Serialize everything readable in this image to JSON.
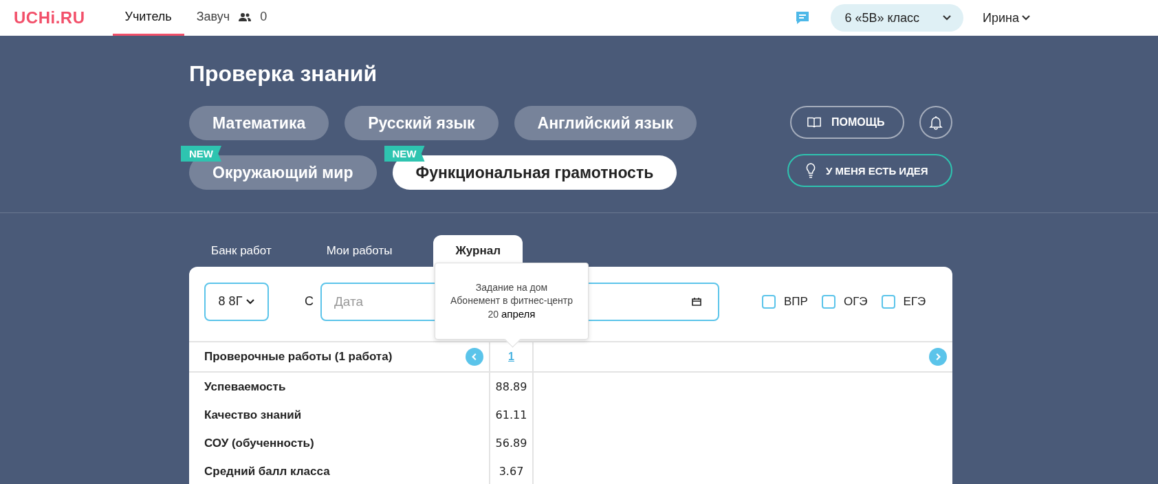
{
  "header": {
    "logo": "UCHi.RU",
    "nav": [
      {
        "label": "Учитель",
        "selected": true
      },
      {
        "label": "Завуч",
        "selected": false,
        "count": "0"
      }
    ],
    "class_selector": "6 «5В» класс",
    "user": "Ирина"
  },
  "title": "Проверка знаний",
  "subject_rows": [
    [
      {
        "label": "Математика",
        "selected": false
      },
      {
        "label": "Русский язык",
        "selected": false
      },
      {
        "label": "Английский язык",
        "selected": false
      }
    ],
    [
      {
        "label": "Окружающий мир",
        "selected": false,
        "badge": "NEW"
      },
      {
        "label": "Функциональная грамотность",
        "selected": true,
        "badge": "NEW"
      }
    ]
  ],
  "help_button": "ПОМОЩЬ",
  "idea_button": "У МЕНЯ ЕСТЬ ИДЕЯ",
  "tabs": [
    {
      "label": "Банк работ",
      "selected": false
    },
    {
      "label": "Мои работы",
      "selected": false
    },
    {
      "label": "Журнал",
      "selected": true
    }
  ],
  "filters": {
    "class": "8 8Г",
    "from_label": "С",
    "date_placeholder": "Дата",
    "exams": [
      {
        "label": "ВПР",
        "checked": false
      },
      {
        "label": "ОГЭ",
        "checked": false
      },
      {
        "label": "ЕГЭ",
        "checked": false
      }
    ]
  },
  "tooltip": {
    "lines": [
      "Задание на дом",
      "Абонемент в фитнес-центр"
    ],
    "day": "20",
    "month": "апреля"
  },
  "table": {
    "header": "Проверочные работы (1 работа)",
    "work_link": "1",
    "rows": [
      {
        "label": "Успеваемость",
        "value": "88.89"
      },
      {
        "label": "Качество знаний",
        "value": "61.11"
      },
      {
        "label": "СОУ (обученность)",
        "value": "56.89"
      },
      {
        "label": "Средний балл класса",
        "value": "3.67"
      }
    ]
  }
}
